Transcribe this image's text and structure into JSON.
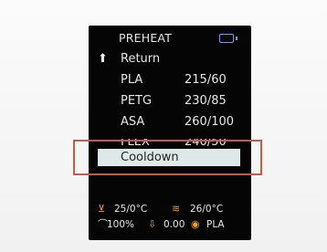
{
  "screen": {
    "title": "PREHEAT",
    "icons": {
      "card": "sd-card-icon",
      "return": "up-arrow-return-icon",
      "bed": "bed-heater-icon",
      "hotend": "hotend-heater-icon",
      "fan": "fan-icon",
      "feed": "feedrate-icon",
      "material": "filament-icon"
    },
    "menu": {
      "return_label": "Return",
      "items": [
        {
          "name": "PLA",
          "temp": "215/60"
        },
        {
          "name": "PETG",
          "temp": "230/85"
        },
        {
          "name": "ASA",
          "temp": "260/100"
        },
        {
          "name": "FLEX",
          "temp": "240/50"
        }
      ],
      "selected_label": "Cooldown"
    },
    "status": {
      "bed_temp": "25/0°C",
      "hotend_temp": "26/0°C",
      "fan_percent": "100%",
      "z_value": "0.00",
      "material": "PLA"
    },
    "colors": {
      "screen_bg": "#050505",
      "selection_bg": "#dfe8e8",
      "highlight_outline": "#c55b4e",
      "accent_orange": "#f2a12f",
      "card_icon": "#6f9cff"
    }
  }
}
